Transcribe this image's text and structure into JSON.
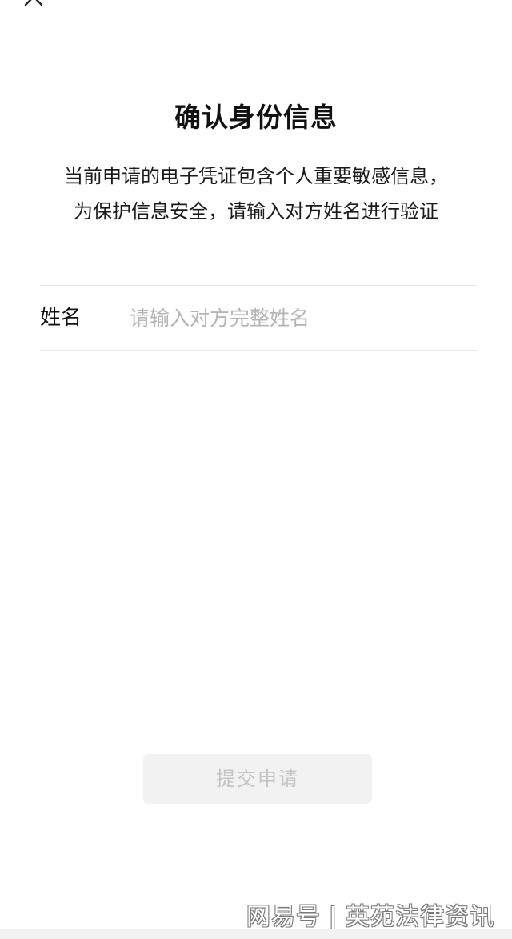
{
  "header": {
    "close_icon": "close-icon"
  },
  "main": {
    "title": "确认身份信息",
    "description_lines": [
      "当前申请的电子凭证包含个人重要敏感信息，",
      "为保护信息安全，请输入对方姓名进行验证"
    ]
  },
  "form": {
    "name_label": "姓名",
    "name_value": "",
    "name_placeholder": "请输入对方完整姓名"
  },
  "actions": {
    "submit_label": "提交申请"
  },
  "watermark": {
    "source": "网易号",
    "separator": "|",
    "account": "英苑法律资讯"
  },
  "colors": {
    "background": "#ffffff",
    "title_text": "#111111",
    "placeholder_text": "#b4b4b4",
    "divider": "#e7e7e7",
    "button_bg_disabled": "#f2f2f2",
    "button_text_disabled": "#c3c3c3"
  }
}
